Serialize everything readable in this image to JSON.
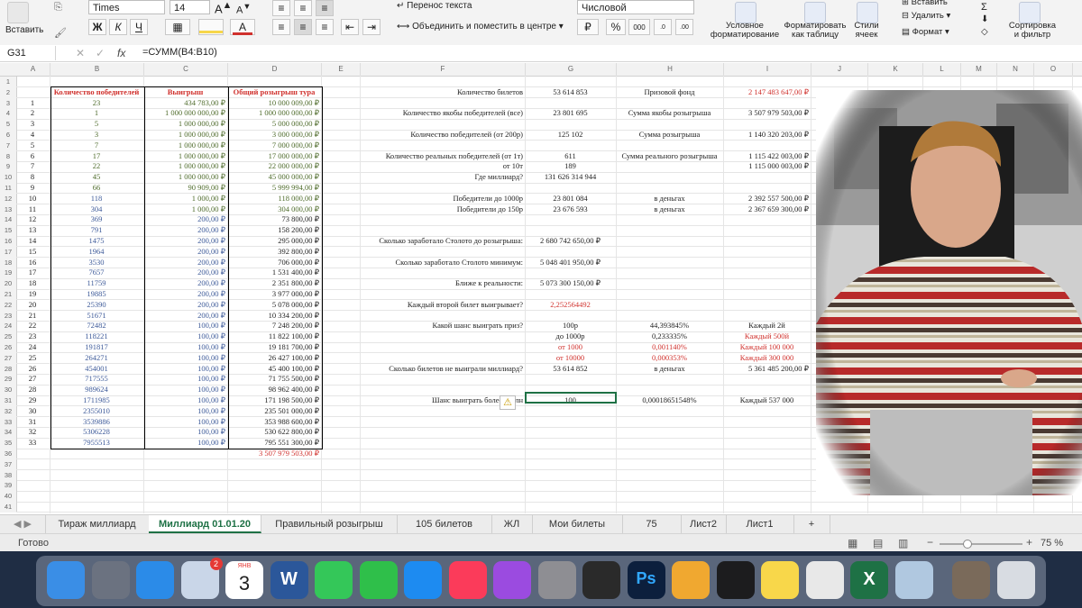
{
  "ribbon": {
    "paste_label": "Вставить",
    "font_name": "Times",
    "font_size": "14",
    "font_grow": "A",
    "font_shrink": "A",
    "bold": "Ж",
    "italic": "К",
    "underline": "Ч",
    "wrap_text": "Перенос текста",
    "merge_center": "Объединить и поместить в центре",
    "number_format": "Числовой",
    "percent": "%",
    "thousands": "000",
    "conditional_format": "Условное форматирование",
    "format_as_table": "Форматировать как таблицу",
    "cell_styles": "Стили ячеек",
    "delete": "Удалить",
    "format": "Формат",
    "insert": "Вставить",
    "sort_filter": "Сортировка и фильтр",
    "colors": {
      "fill": "#f6d64a",
      "font": "#d0312d",
      "excel_green": "#1e7145"
    }
  },
  "formula_bar": {
    "name_box": "G31",
    "fx": "fx",
    "formula": "=СУММ(B4:B10)",
    "cancel": "✕",
    "confirm": "✓"
  },
  "columns": [
    "A",
    "B",
    "C",
    "D",
    "E",
    "F",
    "G",
    "H",
    "I",
    "J",
    "K",
    "L",
    "M",
    "N",
    "O"
  ],
  "rows": [
    "1",
    "2",
    "3",
    "4",
    "5",
    "6",
    "7",
    "8",
    "9",
    "10",
    "11",
    "12",
    "13",
    "14",
    "15",
    "16",
    "17",
    "18",
    "19",
    "20",
    "21",
    "22",
    "23",
    "24",
    "25",
    "26",
    "27",
    "28",
    "29",
    "30",
    "31",
    "32",
    "33",
    "34",
    "35",
    "36",
    "37",
    "38",
    "39",
    "40",
    "41"
  ],
  "table": {
    "headers": {
      "winners": "Количество победителей",
      "prize": "Выигрыш",
      "total": "Общий розыгрыш тура"
    },
    "rows": [
      {
        "n": "1",
        "w": "23",
        "p": "434 783,00 ₽",
        "t": "10 000 009,00 ₽"
      },
      {
        "n": "2",
        "w": "1",
        "p": "1 000 000 000,00 ₽",
        "t": "1 000 000 000,00 ₽"
      },
      {
        "n": "3",
        "w": "5",
        "p": "1 000 000,00 ₽",
        "t": "5 000 000,00 ₽"
      },
      {
        "n": "4",
        "w": "3",
        "p": "1 000 000,00 ₽",
        "t": "3 000 000,00 ₽"
      },
      {
        "n": "5",
        "w": "7",
        "p": "1 000 000,00 ₽",
        "t": "7 000 000,00 ₽"
      },
      {
        "n": "6",
        "w": "17",
        "p": "1 000 000,00 ₽",
        "t": "17 000 000,00 ₽"
      },
      {
        "n": "7",
        "w": "22",
        "p": "1 000 000,00 ₽",
        "t": "22 000 000,00 ₽"
      },
      {
        "n": "8",
        "w": "45",
        "p": "1 000 000,00 ₽",
        "t": "45 000 000,00 ₽"
      },
      {
        "n": "9",
        "w": "66",
        "p": "90 909,00 ₽",
        "t": "5 999 994,00 ₽"
      },
      {
        "n": "10",
        "w": "118",
        "p": "1 000,00 ₽",
        "t": "118 000,00 ₽"
      },
      {
        "n": "11",
        "w": "304",
        "p": "1 000,00 ₽",
        "t": "304 000,00 ₽"
      },
      {
        "n": "12",
        "w": "369",
        "p": "200,00 ₽",
        "t": "73 800,00 ₽"
      },
      {
        "n": "13",
        "w": "791",
        "p": "200,00 ₽",
        "t": "158 200,00 ₽"
      },
      {
        "n": "14",
        "w": "1475",
        "p": "200,00 ₽",
        "t": "295 000,00 ₽"
      },
      {
        "n": "15",
        "w": "1964",
        "p": "200,00 ₽",
        "t": "392 800,00 ₽"
      },
      {
        "n": "16",
        "w": "3530",
        "p": "200,00 ₽",
        "t": "706 000,00 ₽"
      },
      {
        "n": "17",
        "w": "7657",
        "p": "200,00 ₽",
        "t": "1 531 400,00 ₽"
      },
      {
        "n": "18",
        "w": "11759",
        "p": "200,00 ₽",
        "t": "2 351 800,00 ₽"
      },
      {
        "n": "19",
        "w": "19885",
        "p": "200,00 ₽",
        "t": "3 977 000,00 ₽"
      },
      {
        "n": "20",
        "w": "25390",
        "p": "200,00 ₽",
        "t": "5 078 000,00 ₽"
      },
      {
        "n": "21",
        "w": "51671",
        "p": "200,00 ₽",
        "t": "10 334 200,00 ₽"
      },
      {
        "n": "22",
        "w": "72482",
        "p": "100,00 ₽",
        "t": "7 248 200,00 ₽"
      },
      {
        "n": "23",
        "w": "118221",
        "p": "100,00 ₽",
        "t": "11 822 100,00 ₽"
      },
      {
        "n": "24",
        "w": "191817",
        "p": "100,00 ₽",
        "t": "19 181 700,00 ₽"
      },
      {
        "n": "25",
        "w": "264271",
        "p": "100,00 ₽",
        "t": "26 427 100,00 ₽"
      },
      {
        "n": "26",
        "w": "454001",
        "p": "100,00 ₽",
        "t": "45 400 100,00 ₽"
      },
      {
        "n": "27",
        "w": "717555",
        "p": "100,00 ₽",
        "t": "71 755 500,00 ₽"
      },
      {
        "n": "28",
        "w": "989624",
        "p": "100,00 ₽",
        "t": "98 962 400,00 ₽"
      },
      {
        "n": "29",
        "w": "1711985",
        "p": "100,00 ₽",
        "t": "171 198 500,00 ₽"
      },
      {
        "n": "30",
        "w": "2355010",
        "p": "100,00 ₽",
        "t": "235 501 000,00 ₽"
      },
      {
        "n": "31",
        "w": "3539886",
        "p": "100,00 ₽",
        "t": "353 988 600,00 ₽"
      },
      {
        "n": "32",
        "w": "5306228",
        "p": "100,00 ₽",
        "t": "530 622 800,00 ₽"
      },
      {
        "n": "33",
        "w": "7955513",
        "p": "100,00 ₽",
        "t": "795 551 300,00 ₽"
      }
    ],
    "grand_total": "3 507 979 503,00 ₽"
  },
  "stats": [
    {
      "label": "Количество билетов",
      "value": "53 614 853",
      "h": "Призовой фонд",
      "i": "2 147 483 647,00 ₽",
      "i_red": true
    },
    {
      "label": "Количество якобы победителей (все)",
      "value": "23 801 695",
      "h": "Сумма якобы розыгрыша",
      "i": "3 507 979 503,00 ₽"
    },
    {
      "label": "Количество победителей (от 200р)",
      "value": "125 102",
      "h": "Сумма розыгрыша",
      "i": "1 140 320 203,00 ₽"
    },
    {
      "label": "Количество реальных победителей (от 1т)",
      "value": "611",
      "h": "Сумма реального розыгрыша",
      "i": "1 115 422 003,00 ₽"
    },
    {
      "label": "от 10т",
      "value": "189",
      "h": "",
      "i": "1 115 000 003,00 ₽"
    },
    {
      "label": "Где миллиард?",
      "value": "131 626 314 944",
      "h": "",
      "i": ""
    },
    {
      "label": "Победители до 1000р",
      "value": "23 801 084",
      "h": "в деньгах",
      "i": "2 392 557 500,00 ₽"
    },
    {
      "label": "Победители до 150р",
      "value": "23 676 593",
      "h": "в деньгах",
      "i": "2 367 659 300,00 ₽"
    },
    {
      "label": "Сколько заработало Столото до розыгрыша:",
      "value": "2 680 742 650,00 ₽"
    },
    {
      "label": "Сколько заработало Столото минимум:",
      "value": "5 048 401 950,00 ₽"
    },
    {
      "label": "Ближе к реальности:",
      "value": "5 073 300 150,00 ₽"
    },
    {
      "label": "Каждый второй билет выигрывает?",
      "value": "2,252564492"
    },
    {
      "label": "Какой шанс выиграть приз?",
      "value": "100р",
      "h": "44,393845%",
      "i": "Каждый 2й"
    },
    {
      "label": "",
      "value": "до 1000р",
      "h": "0,233335%",
      "i": "Каждый 500й"
    },
    {
      "label": "",
      "value": "от 1000",
      "h": "0,001140%",
      "i": "Каждый 100 000"
    },
    {
      "label": "",
      "value": "от 10000",
      "h": "0,000353%",
      "i": "Каждый 300 000"
    },
    {
      "label": "Сколько билетов не выиграли миллиард?",
      "value": "53 614 852",
      "h": "в деньгах",
      "i": "5 361 485 200,00 ₽"
    },
    {
      "label": "Шанс выиграть более 1 млн",
      "value": "100",
      "h": "0,00018651548%",
      "i": "Каждый 537 000"
    }
  ],
  "tabs": [
    "Тираж миллиард",
    "Миллиард 01.01.20",
    "Правильный розыгрыш",
    "105 билетов",
    "ЖЛ",
    "Мои билеты",
    "75",
    "Лист2",
    "Лист1",
    "+"
  ],
  "status": {
    "ready": "Готово",
    "zoom": "75 %",
    "minus": "−",
    "plus": "+"
  },
  "dock": [
    "finder",
    "launchpad",
    "safari",
    "mail-badge",
    "calendar",
    "word",
    "messages",
    "facetime",
    "app-store",
    "music",
    "podcasts",
    "system-preferences",
    "final-cut",
    "photoshop",
    "garageband",
    "quicktime",
    "notes",
    "chrome",
    "excel",
    "preview",
    "downloads-stack",
    "trash"
  ],
  "dock_mail_badge": "2",
  "calendar_day": "3",
  "calendar_month": "ЯНВ",
  "ps_label": "Ps",
  "word_label": "W",
  "excel_label": "X"
}
